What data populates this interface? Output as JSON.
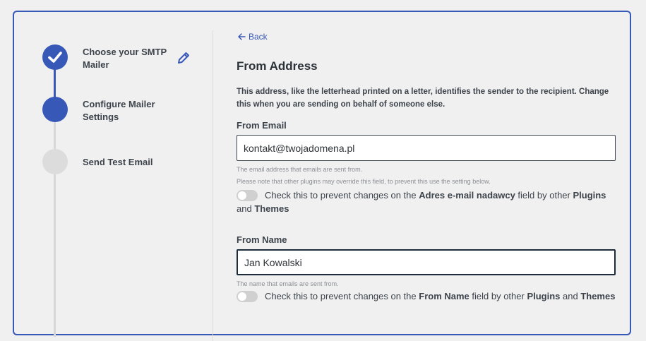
{
  "steps": [
    {
      "line1": "Choose your SMTP",
      "line2": "Mailer",
      "state": "done"
    },
    {
      "line1": "Configure Mailer",
      "line2": "Settings",
      "state": "current"
    },
    {
      "line1": "Send Test Email",
      "line2": "",
      "state": "todo"
    }
  ],
  "icons": {
    "step_done": "checkmark-icon",
    "edit": "pencil-icon",
    "back": "arrow-left-icon"
  },
  "colors": {
    "accent": "#3858b7",
    "inactive": "#dcdcdc"
  },
  "back_label": "Back",
  "section": {
    "title": "From Address",
    "description": "This address, like the letterhead printed on a letter, identifies the sender to the recipient. Change this when you are sending on behalf of someone else."
  },
  "from_email": {
    "label": "From Email",
    "value": "kontakt@twojadomena.pl",
    "help1": "The email address that emails are sent from.",
    "help2": "Please note that other plugins may override this field, to prevent this use the setting below.",
    "toggle": {
      "prefix": "Check this to prevent changes on the ",
      "field": "Adres e-mail nadawcy",
      "middle": " field by other ",
      "plugins": "Plugins",
      "and": " and ",
      "themes": "Themes",
      "on": false
    }
  },
  "from_name": {
    "label": "From Name",
    "value": "Jan Kowalski",
    "help1": "The name that emails are sent from.",
    "toggle": {
      "prefix": "Check this to prevent changes on the ",
      "field": "From Name",
      "middle": " field by other ",
      "plugins": "Plugins",
      "and": " and ",
      "themes": "Themes",
      "on": false
    }
  }
}
